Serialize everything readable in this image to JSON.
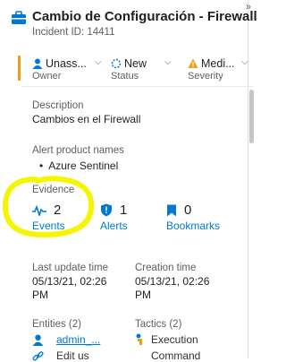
{
  "panel": {
    "title": "Cambio de Configuración - Firewall",
    "incident_id": "Incident ID: 14411"
  },
  "fields": {
    "owner": {
      "value": "Unass...",
      "label": "Owner"
    },
    "status": {
      "value": "New",
      "label": "Status"
    },
    "severity": {
      "value": "Medi...",
      "label": "Severity"
    }
  },
  "description": {
    "label": "Description",
    "value": "Cambios en el Firewall"
  },
  "alert_products": {
    "label": "Alert product names",
    "items": [
      "Azure Sentinel"
    ]
  },
  "evidence": {
    "label": "Evidence",
    "events": {
      "count": "2",
      "label": "Events"
    },
    "alerts": {
      "count": "1",
      "label": "Alerts"
    },
    "bookmarks": {
      "count": "0",
      "label": "Bookmarks"
    }
  },
  "times": {
    "last_update": {
      "label": "Last update time",
      "line1": "05/13/21, 02:26",
      "line2": "PM"
    },
    "creation": {
      "label": "Creation time",
      "line1": "05/13/21, 02:26",
      "line2": "PM"
    }
  },
  "entities": {
    "label": "Entities (2)",
    "item1": "admin_...",
    "item2": "Edit us"
  },
  "tactics": {
    "label": "Tactics (2)",
    "item1": "Execution",
    "item2": "Command"
  },
  "colors": {
    "accent": "#0078d4",
    "highlight": "#f5f500",
    "severity_orange": "#e3a21a",
    "owner_blue": "#0078d4"
  }
}
